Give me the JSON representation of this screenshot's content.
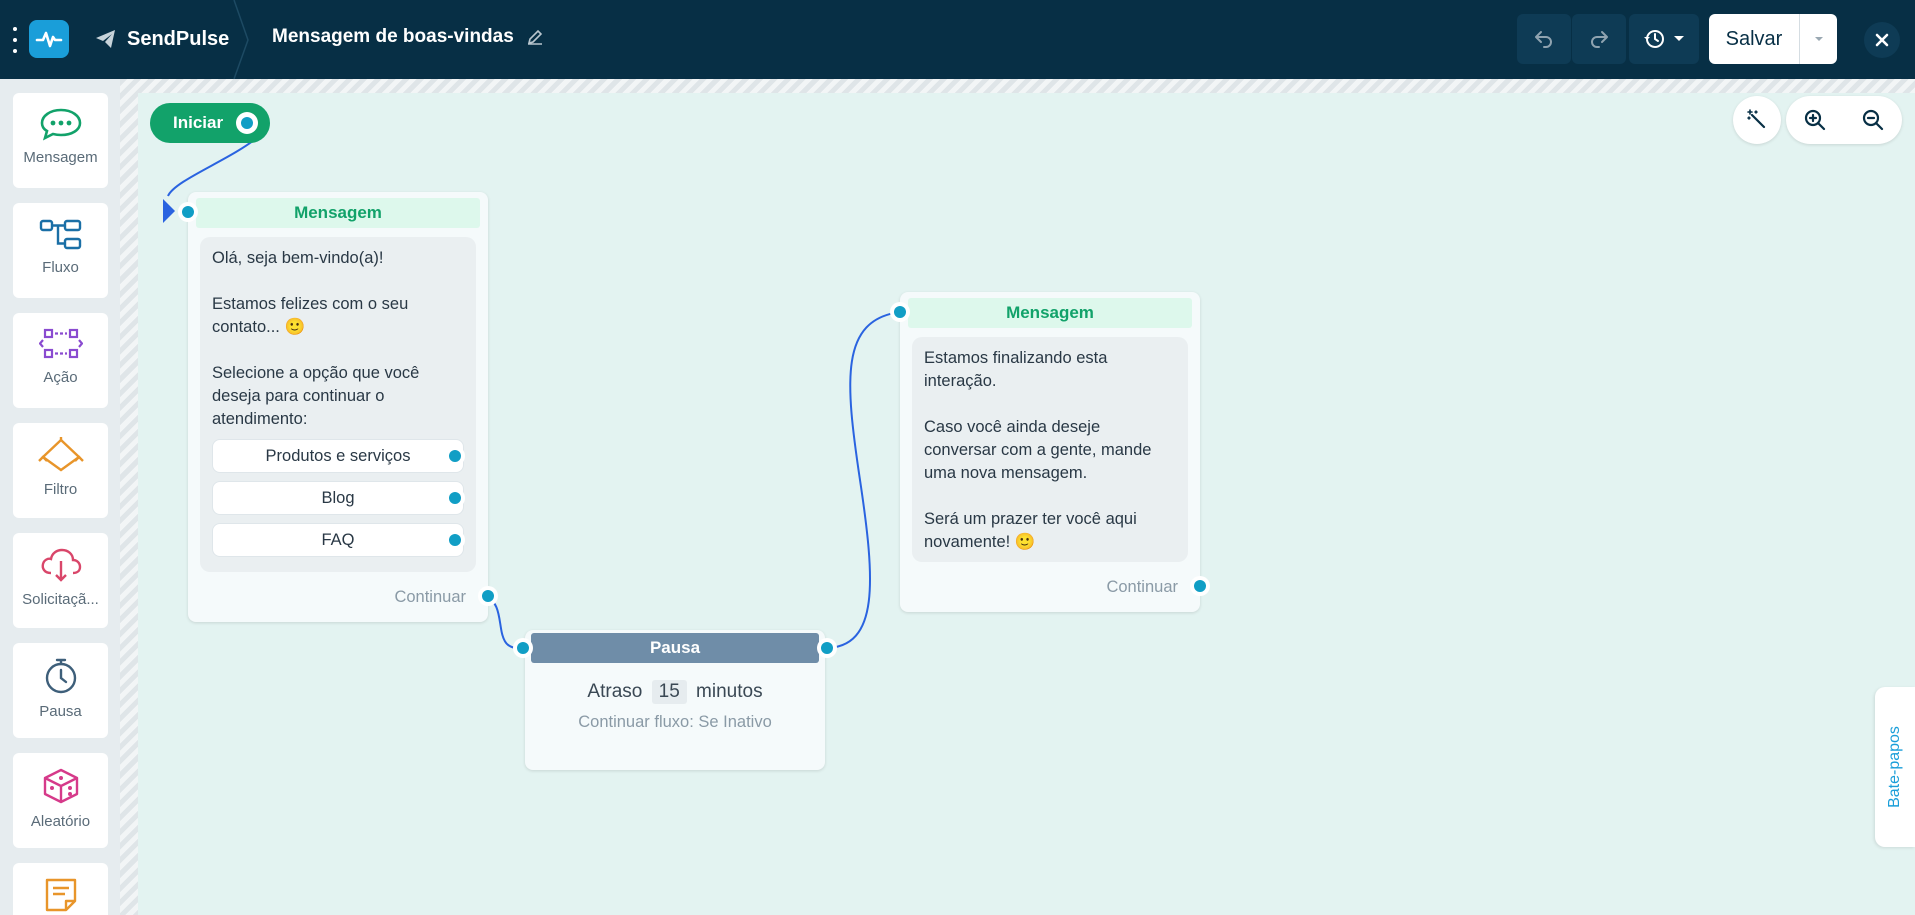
{
  "colors": {
    "topbar": "#072f45",
    "brand_blue": "#1a9ed9",
    "green": "#12a26a",
    "port": "#119ec5",
    "wire": "#2a63e0",
    "pause_head": "#6f8da8",
    "canvas": "#e3f3f1"
  },
  "header": {
    "brand": "SendPulse",
    "flow_title": "Mensagem de boas-vindas",
    "save_label": "Salvar"
  },
  "sidebar": {
    "items": [
      {
        "label": "Mensagem",
        "icon": "chat-bubble-icon"
      },
      {
        "label": "Fluxo",
        "icon": "flow-icon"
      },
      {
        "label": "Ação",
        "icon": "action-icon"
      },
      {
        "label": "Filtro",
        "icon": "filter-icon"
      },
      {
        "label": "Solicitaçã...",
        "icon": "request-cloud-icon"
      },
      {
        "label": "Pausa",
        "icon": "stopwatch-icon"
      },
      {
        "label": "Aleatório",
        "icon": "dice-icon"
      },
      {
        "label": "",
        "icon": "note-icon"
      }
    ]
  },
  "canvas": {
    "start_label": "Iniciar",
    "message1": {
      "header": "Mensagem",
      "text": [
        "Olá, seja bem-vindo(a)!",
        "Estamos felizes com o seu contato... 🙂",
        "Selecione a opção que você deseja para continuar o atendimento:"
      ],
      "options": [
        "Produtos e serviços",
        "Blog",
        "FAQ"
      ],
      "continue": "Continuar"
    },
    "pause": {
      "header": "Pausa",
      "delay_prefix": "Atraso",
      "delay_value": "15",
      "delay_unit": "minutos",
      "subtitle": "Continuar fluxo: Se Inativo"
    },
    "message2": {
      "header": "Mensagem",
      "text": [
        "Estamos finalizando esta interação.",
        "Caso você ainda deseje conversar com a gente, mande uma nova mensagem.",
        "Será um prazer ter você aqui novamente! 🙂"
      ],
      "continue": "Continuar"
    }
  },
  "side_tab": "Bate-papos"
}
